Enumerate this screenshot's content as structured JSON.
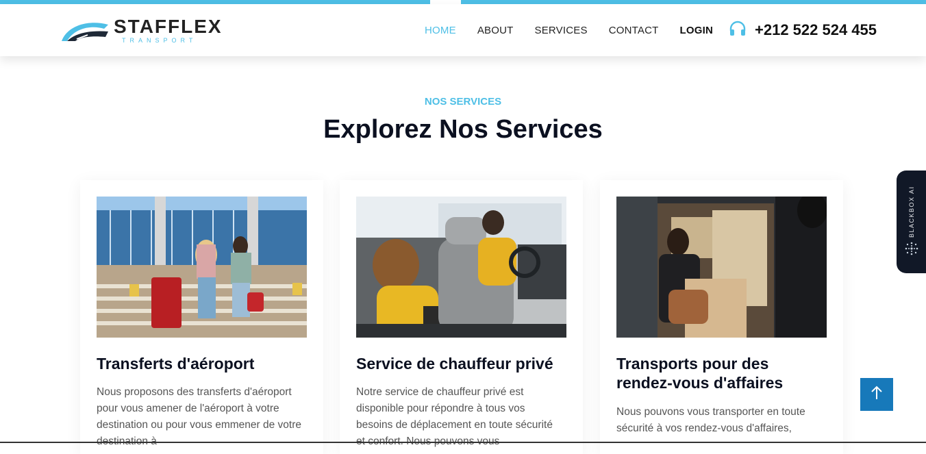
{
  "brand": {
    "name": "STAFFLEX",
    "tagline": "TRANSPORT",
    "accent": "#4ebfe6"
  },
  "nav": {
    "items": [
      {
        "label": "HOME",
        "active": true
      },
      {
        "label": "ABOUT",
        "active": false
      },
      {
        "label": "SERVICES",
        "active": false
      },
      {
        "label": "CONTACT",
        "active": false
      },
      {
        "label": "LOGIN",
        "active": false
      }
    ],
    "phone": "+212 522 524 455",
    "phone_icon": "headset-icon"
  },
  "section": {
    "tag": "NOS SERVICES",
    "title": "Explorez Nos Services"
  },
  "cards": [
    {
      "title": "Transferts d'aéroport",
      "text": "Nous proposons des transferts d'aéroport pour vous amener de l'aéroport à votre destination ou pour vous emmener de votre destination à"
    },
    {
      "title": "Service de chauffeur privé",
      "text": "Notre service de chauffeur privé est disponible pour répondre à tous vos besoins de déplacement en toute sécurité et confort. Nous pouvons vous"
    },
    {
      "title": "Transports pour des rendez-vous d'affaires",
      "text": "Nous pouvons vous transporter en toute sécurité à vos rendez-vous d'affaires,"
    }
  ],
  "widget": {
    "label": "BLACKBOX AI"
  },
  "scroll_top_icon": "arrow-up-icon"
}
